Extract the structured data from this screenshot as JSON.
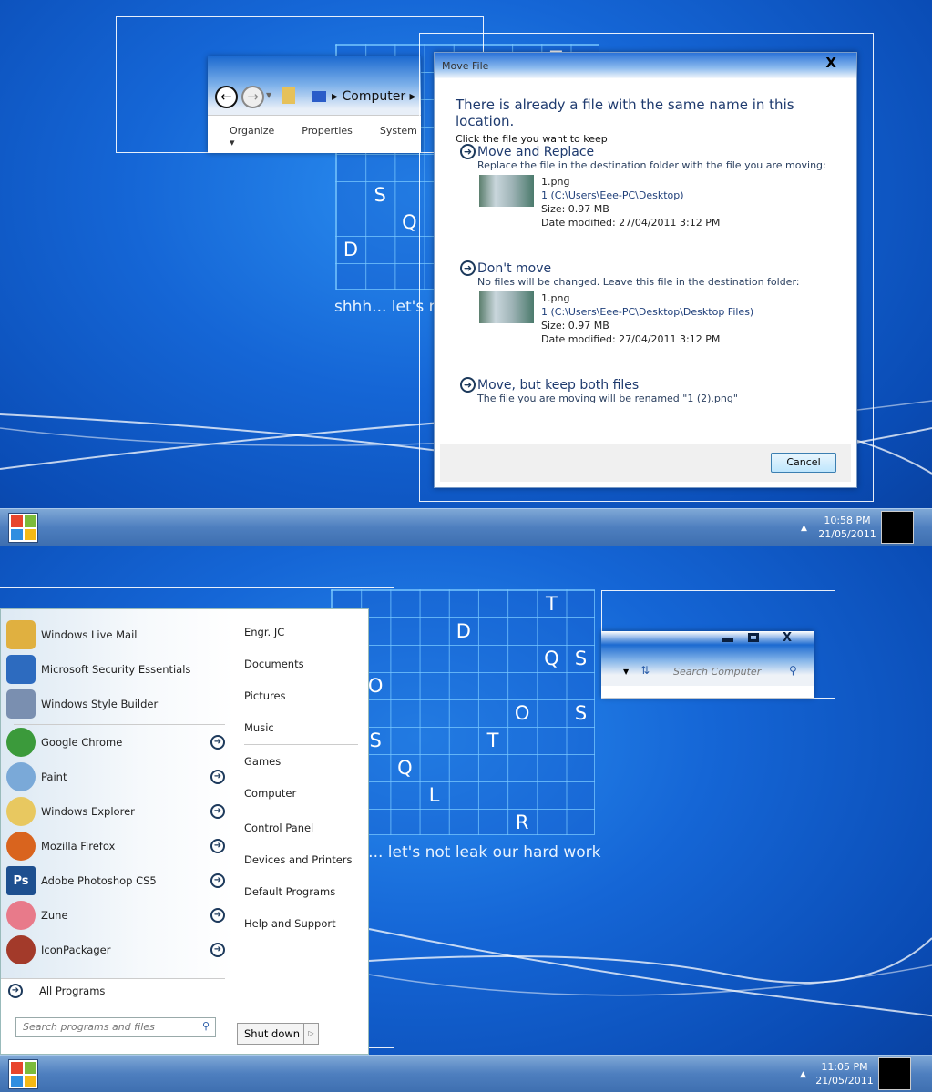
{
  "top": {
    "grid_letters": [
      {
        "ch": "T",
        "col": 7,
        "row": 0
      },
      {
        "ch": "S",
        "col": 1,
        "row": 5
      },
      {
        "ch": "Q",
        "col": 2,
        "row": 6
      },
      {
        "ch": "D",
        "col": 0,
        "row": 7
      }
    ],
    "tagline": "shhh... let's not leak our hard work",
    "explorer": {
      "breadcrumb": "Computer",
      "toolbar": [
        "Organize ▾",
        "Properties",
        "System"
      ]
    },
    "dialog": {
      "title": "Move File",
      "heading": "There is already a file with the same name in this location.",
      "instruction": "Click the file you want to keep",
      "options": [
        {
          "title": "Move and Replace",
          "desc": "Replace the file in the destination folder with the file you are moving:",
          "file": {
            "name": "1.png",
            "path": "1 (C:\\Users\\Eee-PC\\Desktop)",
            "size": "Size: 0.97 MB",
            "date": "Date modified: 27/04/2011 3:12 PM"
          }
        },
        {
          "title": "Don't move",
          "desc": "No files will be changed. Leave this file in the destination folder:",
          "file": {
            "name": "1.png",
            "path": "1 (C:\\Users\\Eee-PC\\Desktop\\Desktop Files)",
            "size": "Size: 0.97 MB",
            "date": "Date modified: 27/04/2011 3:12 PM"
          }
        },
        {
          "title": "Move, but keep both files",
          "desc": "The file you are moving will be renamed \"1 (2).png\""
        }
      ],
      "cancel": "Cancel"
    },
    "clock": {
      "time": "10:58 PM",
      "date": "21/05/2011"
    }
  },
  "bottom": {
    "grid_letters": [
      {
        "ch": "T",
        "col": 7,
        "row": 0
      },
      {
        "ch": "D",
        "col": 4,
        "row": 1
      },
      {
        "ch": "Q",
        "col": 7,
        "row": 2
      },
      {
        "ch": "S",
        "col": 8,
        "row": 2
      },
      {
        "ch": "O",
        "col": 1,
        "row": 3
      },
      {
        "ch": "O",
        "col": 6,
        "row": 4
      },
      {
        "ch": "S",
        "col": 8,
        "row": 4
      },
      {
        "ch": "S",
        "col": 1,
        "row": 5
      },
      {
        "ch": "T",
        "col": 5,
        "row": 5
      },
      {
        "ch": "Q",
        "col": 2,
        "row": 6
      },
      {
        "ch": "L",
        "col": 3,
        "row": 7
      },
      {
        "ch": "R",
        "col": 6,
        "row": 8
      }
    ],
    "tagline": "shhh... let's not leak our hard work",
    "explorer": {
      "search_placeholder": "Search Computer"
    },
    "start_menu": {
      "pinned": [
        {
          "label": "Windows Live Mail",
          "color": "#e0b040"
        },
        {
          "label": "Microsoft Security Essentials",
          "color": "#2d6bbf"
        },
        {
          "label": "Windows Style Builder",
          "color": "#7a8fb0"
        }
      ],
      "recent": [
        {
          "label": "Google Chrome",
          "color": "#3b9a3b"
        },
        {
          "label": "Paint",
          "color": "#7aa9d8"
        },
        {
          "label": "Windows Explorer",
          "color": "#e8c860"
        },
        {
          "label": "Mozilla Firefox",
          "color": "#d9641e"
        },
        {
          "label": "Adobe Photoshop CS5",
          "color": "#1d4f8f",
          "glyph": "Ps"
        },
        {
          "label": "Zune",
          "color": "#e87a8a"
        },
        {
          "label": "IconPackager",
          "color": "#a33a2a"
        }
      ],
      "all_programs": "All Programs",
      "search_placeholder": "Search programs and files",
      "right": [
        "Engr. JC",
        "Documents",
        "Pictures",
        "Music",
        "Games",
        "Computer",
        "Control Panel",
        "Devices and Printers",
        "Default Programs",
        "Help and Support"
      ],
      "shutdown": "Shut down"
    },
    "clock": {
      "time": "11:05 PM",
      "date": "21/05/2011"
    }
  }
}
